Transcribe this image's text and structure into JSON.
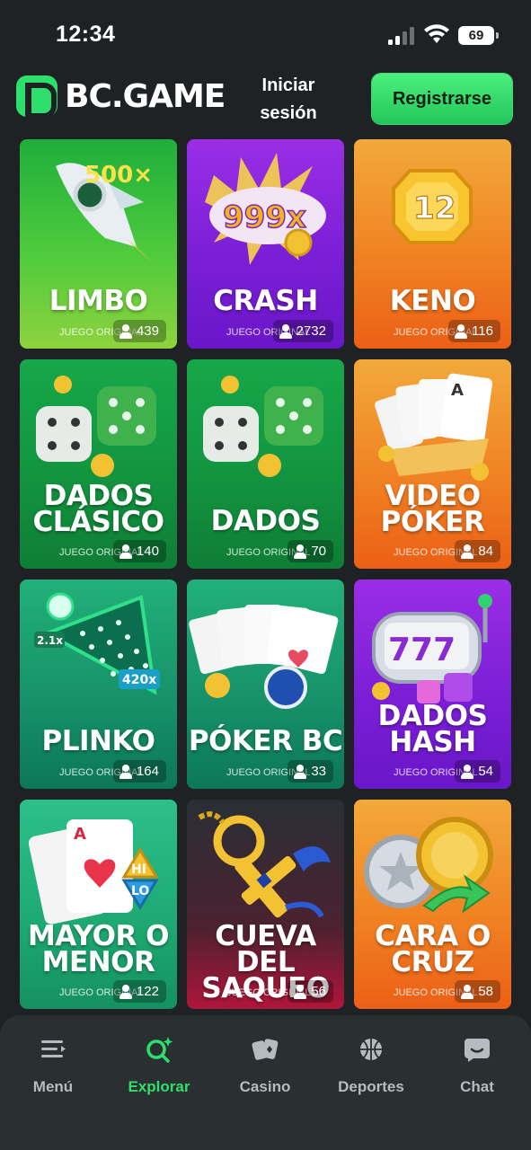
{
  "status_bar": {
    "time": "12:34",
    "battery": "69"
  },
  "header": {
    "logo_text": "BC.GAME",
    "login_label_line1": "Iniciar",
    "login_label_line2": "sesión",
    "register_label": "Registrarse"
  },
  "games": [
    {
      "title_lines": [
        "LIMBO"
      ],
      "art_text": "500×",
      "badge": "JUEGO ORIGINAL",
      "players": "439"
    },
    {
      "title_lines": [
        "CRASH"
      ],
      "art_text": "999x",
      "badge": "JUEGO ORIGINAL",
      "players": "2732"
    },
    {
      "title_lines": [
        "KENO"
      ],
      "art_text": "12",
      "badge": "JUEGO ORIGINAL",
      "players": "116"
    },
    {
      "title_lines": [
        "DADOS",
        "CLÁSICO"
      ],
      "badge": "JUEGO ORIGINAL",
      "players": "140"
    },
    {
      "title_lines": [
        "DADOS"
      ],
      "badge": "JUEGO ORIGINAL",
      "players": "70"
    },
    {
      "title_lines": [
        "VIDEO",
        "PÓKER"
      ],
      "badge": "JUEGO ORIGINAL",
      "players": "84"
    },
    {
      "title_lines": [
        "PLINKO"
      ],
      "art_text_a": "2.1x",
      "art_text_b": "420x",
      "badge": "JUEGO ORIGINAL",
      "players": "164"
    },
    {
      "title_lines": [
        "PÓKER BC"
      ],
      "badge": "JUEGO ORIGINAL",
      "players": "33"
    },
    {
      "title_lines": [
        "DADOS",
        "HASH"
      ],
      "art_text": "777",
      "badge": "JUEGO ORIGINAL",
      "players": "54"
    },
    {
      "title_lines": [
        "MAYOR O",
        "MENOR"
      ],
      "art_text_a": "HI",
      "art_text_b": "LO",
      "badge": "JUEGO ORIGINAL",
      "players": "122"
    },
    {
      "title_lines": [
        "CUEVA DEL",
        "SAQUEO"
      ],
      "badge": "JUEGO ORIGINAL",
      "players": "56"
    },
    {
      "title_lines": [
        "CARA O",
        "CRUZ"
      ],
      "badge": "JUEGO ORIGINAL",
      "players": "58"
    }
  ],
  "bottom_nav": [
    {
      "label": "Menú",
      "icon": "menu-icon",
      "active": false
    },
    {
      "label": "Explorar",
      "icon": "explore-search-icon",
      "active": true
    },
    {
      "label": "Casino",
      "icon": "cards-icon",
      "active": false
    },
    {
      "label": "Deportes",
      "icon": "basketball-icon",
      "active": false
    },
    {
      "label": "Chat",
      "icon": "chat-icon",
      "active": false
    }
  ],
  "colors": {
    "brand_green": "#2ee06b",
    "background": "#1e2224",
    "nav_bg": "#2a2f31"
  }
}
